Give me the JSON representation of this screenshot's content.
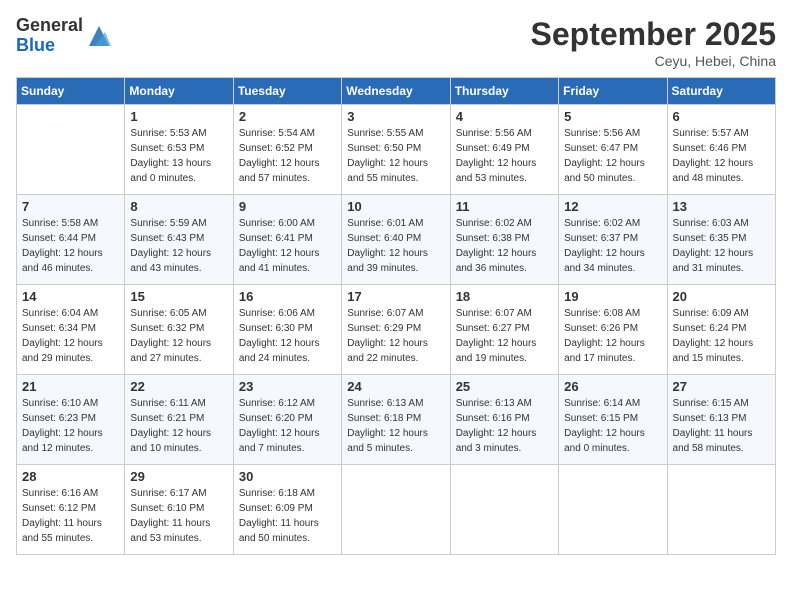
{
  "header": {
    "logo_general": "General",
    "logo_blue": "Blue",
    "month_title": "September 2025",
    "subtitle": "Ceyu, Hebei, China"
  },
  "days_of_week": [
    "Sunday",
    "Monday",
    "Tuesday",
    "Wednesday",
    "Thursday",
    "Friday",
    "Saturday"
  ],
  "weeks": [
    [
      {
        "day": "",
        "info": ""
      },
      {
        "day": "1",
        "info": "Sunrise: 5:53 AM\nSunset: 6:53 PM\nDaylight: 13 hours\nand 0 minutes."
      },
      {
        "day": "2",
        "info": "Sunrise: 5:54 AM\nSunset: 6:52 PM\nDaylight: 12 hours\nand 57 minutes."
      },
      {
        "day": "3",
        "info": "Sunrise: 5:55 AM\nSunset: 6:50 PM\nDaylight: 12 hours\nand 55 minutes."
      },
      {
        "day": "4",
        "info": "Sunrise: 5:56 AM\nSunset: 6:49 PM\nDaylight: 12 hours\nand 53 minutes."
      },
      {
        "day": "5",
        "info": "Sunrise: 5:56 AM\nSunset: 6:47 PM\nDaylight: 12 hours\nand 50 minutes."
      },
      {
        "day": "6",
        "info": "Sunrise: 5:57 AM\nSunset: 6:46 PM\nDaylight: 12 hours\nand 48 minutes."
      }
    ],
    [
      {
        "day": "7",
        "info": "Sunrise: 5:58 AM\nSunset: 6:44 PM\nDaylight: 12 hours\nand 46 minutes."
      },
      {
        "day": "8",
        "info": "Sunrise: 5:59 AM\nSunset: 6:43 PM\nDaylight: 12 hours\nand 43 minutes."
      },
      {
        "day": "9",
        "info": "Sunrise: 6:00 AM\nSunset: 6:41 PM\nDaylight: 12 hours\nand 41 minutes."
      },
      {
        "day": "10",
        "info": "Sunrise: 6:01 AM\nSunset: 6:40 PM\nDaylight: 12 hours\nand 39 minutes."
      },
      {
        "day": "11",
        "info": "Sunrise: 6:02 AM\nSunset: 6:38 PM\nDaylight: 12 hours\nand 36 minutes."
      },
      {
        "day": "12",
        "info": "Sunrise: 6:02 AM\nSunset: 6:37 PM\nDaylight: 12 hours\nand 34 minutes."
      },
      {
        "day": "13",
        "info": "Sunrise: 6:03 AM\nSunset: 6:35 PM\nDaylight: 12 hours\nand 31 minutes."
      }
    ],
    [
      {
        "day": "14",
        "info": "Sunrise: 6:04 AM\nSunset: 6:34 PM\nDaylight: 12 hours\nand 29 minutes."
      },
      {
        "day": "15",
        "info": "Sunrise: 6:05 AM\nSunset: 6:32 PM\nDaylight: 12 hours\nand 27 minutes."
      },
      {
        "day": "16",
        "info": "Sunrise: 6:06 AM\nSunset: 6:30 PM\nDaylight: 12 hours\nand 24 minutes."
      },
      {
        "day": "17",
        "info": "Sunrise: 6:07 AM\nSunset: 6:29 PM\nDaylight: 12 hours\nand 22 minutes."
      },
      {
        "day": "18",
        "info": "Sunrise: 6:07 AM\nSunset: 6:27 PM\nDaylight: 12 hours\nand 19 minutes."
      },
      {
        "day": "19",
        "info": "Sunrise: 6:08 AM\nSunset: 6:26 PM\nDaylight: 12 hours\nand 17 minutes."
      },
      {
        "day": "20",
        "info": "Sunrise: 6:09 AM\nSunset: 6:24 PM\nDaylight: 12 hours\nand 15 minutes."
      }
    ],
    [
      {
        "day": "21",
        "info": "Sunrise: 6:10 AM\nSunset: 6:23 PM\nDaylight: 12 hours\nand 12 minutes."
      },
      {
        "day": "22",
        "info": "Sunrise: 6:11 AM\nSunset: 6:21 PM\nDaylight: 12 hours\nand 10 minutes."
      },
      {
        "day": "23",
        "info": "Sunrise: 6:12 AM\nSunset: 6:20 PM\nDaylight: 12 hours\nand 7 minutes."
      },
      {
        "day": "24",
        "info": "Sunrise: 6:13 AM\nSunset: 6:18 PM\nDaylight: 12 hours\nand 5 minutes."
      },
      {
        "day": "25",
        "info": "Sunrise: 6:13 AM\nSunset: 6:16 PM\nDaylight: 12 hours\nand 3 minutes."
      },
      {
        "day": "26",
        "info": "Sunrise: 6:14 AM\nSunset: 6:15 PM\nDaylight: 12 hours\nand 0 minutes."
      },
      {
        "day": "27",
        "info": "Sunrise: 6:15 AM\nSunset: 6:13 PM\nDaylight: 11 hours\nand 58 minutes."
      }
    ],
    [
      {
        "day": "28",
        "info": "Sunrise: 6:16 AM\nSunset: 6:12 PM\nDaylight: 11 hours\nand 55 minutes."
      },
      {
        "day": "29",
        "info": "Sunrise: 6:17 AM\nSunset: 6:10 PM\nDaylight: 11 hours\nand 53 minutes."
      },
      {
        "day": "30",
        "info": "Sunrise: 6:18 AM\nSunset: 6:09 PM\nDaylight: 11 hours\nand 50 minutes."
      },
      {
        "day": "",
        "info": ""
      },
      {
        "day": "",
        "info": ""
      },
      {
        "day": "",
        "info": ""
      },
      {
        "day": "",
        "info": ""
      }
    ]
  ]
}
